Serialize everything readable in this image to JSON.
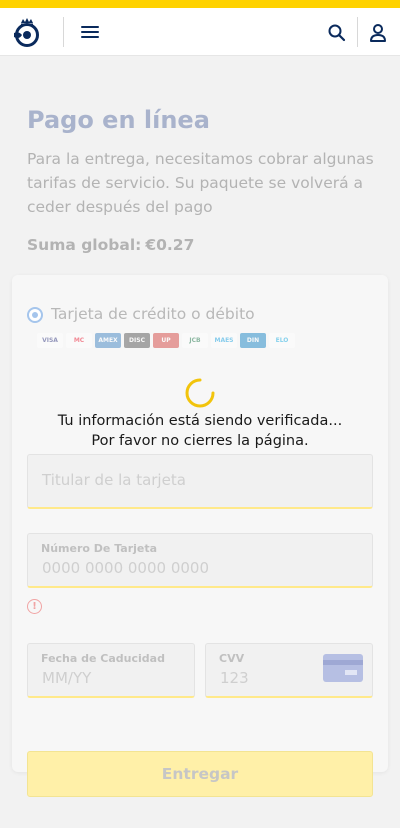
{
  "brand_colors": {
    "accent_yellow": "#ffd200",
    "navy": "#0a2a5c"
  },
  "header": {
    "logo_icon": "correos-horn-crown-icon",
    "menu_icon": "hamburger-menu-icon",
    "search_icon": "search-icon",
    "user_icon": "user-icon"
  },
  "page": {
    "title": "Pago en línea",
    "description": "Para la entrega, necesitamos cobrar algunas tarifas de servicio. Su paquete se volverá a ceder después del pago",
    "total_label": "Suma global:",
    "total_value": "€0.27"
  },
  "payment": {
    "method_label": "Tarjeta de crédito o débito",
    "card_brands": [
      "VISA",
      "MC",
      "AMEX",
      "DISC",
      "UP",
      "JCB",
      "MAES",
      "DIN",
      "ELO"
    ],
    "holder_placeholder": "Titular de la tarjeta",
    "card_number_label": "Número De Tarjeta",
    "card_number_placeholder": "0000 0000 0000 0000",
    "expiry_label": "Fecha de Caducidad",
    "expiry_placeholder": "MM/YY",
    "cvv_label": "CVV",
    "cvv_placeholder": "123",
    "submit_label": "Entregar"
  },
  "overlay": {
    "line1": "Tu información está siendo verificada...",
    "line2": "Por favor no cierres la página.",
    "spinner_color": "#f2c40c"
  }
}
